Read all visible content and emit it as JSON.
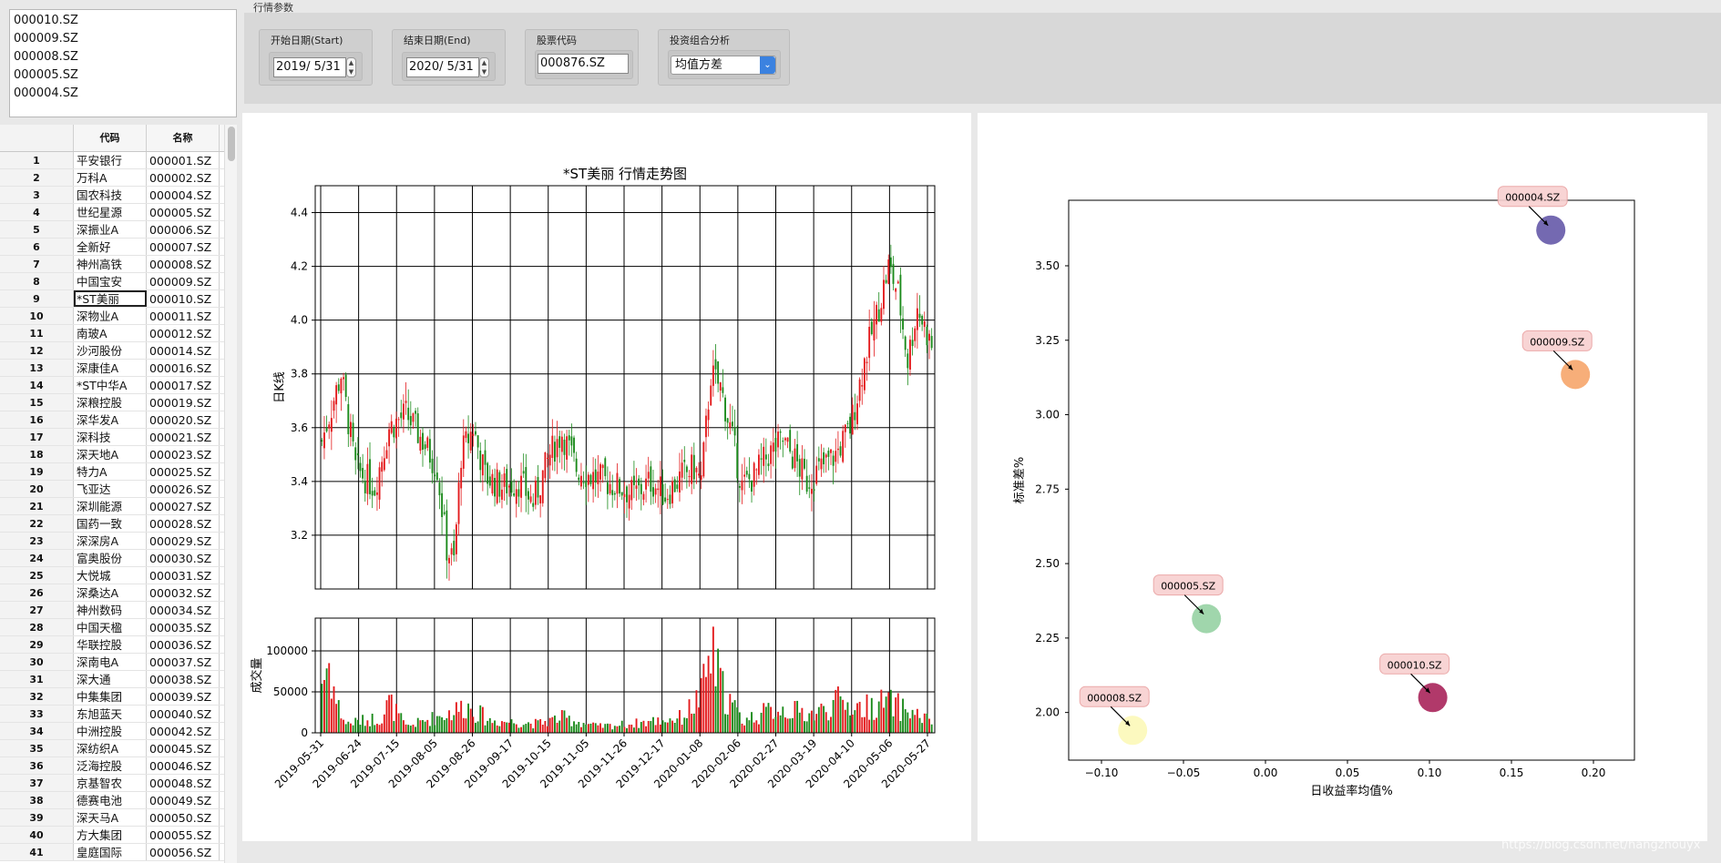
{
  "selected_list": [
    "000010.SZ",
    "000009.SZ",
    "000008.SZ",
    "000005.SZ",
    "000004.SZ"
  ],
  "table": {
    "headers": {
      "num": "",
      "col1": "代码",
      "col2": "名称"
    },
    "selected_row": 9,
    "rows": [
      {
        "num": "1",
        "name": "平安银行",
        "code": "000001.SZ"
      },
      {
        "num": "2",
        "name": "万科A",
        "code": "000002.SZ"
      },
      {
        "num": "3",
        "name": "国农科技",
        "code": "000004.SZ"
      },
      {
        "num": "4",
        "name": "世纪星源",
        "code": "000005.SZ"
      },
      {
        "num": "5",
        "name": "深振业A",
        "code": "000006.SZ"
      },
      {
        "num": "6",
        "name": "全新好",
        "code": "000007.SZ"
      },
      {
        "num": "7",
        "name": "神州高铁",
        "code": "000008.SZ"
      },
      {
        "num": "8",
        "name": "中国宝安",
        "code": "000009.SZ"
      },
      {
        "num": "9",
        "name": "*ST美丽",
        "code": "000010.SZ"
      },
      {
        "num": "10",
        "name": "深物业A",
        "code": "000011.SZ"
      },
      {
        "num": "11",
        "name": "南玻A",
        "code": "000012.SZ"
      },
      {
        "num": "12",
        "name": "沙河股份",
        "code": "000014.SZ"
      },
      {
        "num": "13",
        "name": "深康佳A",
        "code": "000016.SZ"
      },
      {
        "num": "14",
        "name": "*ST中华A",
        "code": "000017.SZ"
      },
      {
        "num": "15",
        "name": "深粮控股",
        "code": "000019.SZ"
      },
      {
        "num": "16",
        "name": "深华发A",
        "code": "000020.SZ"
      },
      {
        "num": "17",
        "name": "深科技",
        "code": "000021.SZ"
      },
      {
        "num": "18",
        "name": "深天地A",
        "code": "000023.SZ"
      },
      {
        "num": "19",
        "name": "特力A",
        "code": "000025.SZ"
      },
      {
        "num": "20",
        "name": "飞亚达",
        "code": "000026.SZ"
      },
      {
        "num": "21",
        "name": "深圳能源",
        "code": "000027.SZ"
      },
      {
        "num": "22",
        "name": "国药一致",
        "code": "000028.SZ"
      },
      {
        "num": "23",
        "name": "深深房A",
        "code": "000029.SZ"
      },
      {
        "num": "24",
        "name": "富奥股份",
        "code": "000030.SZ"
      },
      {
        "num": "25",
        "name": "大悦城",
        "code": "000031.SZ"
      },
      {
        "num": "26",
        "name": "深桑达A",
        "code": "000032.SZ"
      },
      {
        "num": "27",
        "name": "神州数码",
        "code": "000034.SZ"
      },
      {
        "num": "28",
        "name": "中国天楹",
        "code": "000035.SZ"
      },
      {
        "num": "29",
        "name": "华联控股",
        "code": "000036.SZ"
      },
      {
        "num": "30",
        "name": "深南电A",
        "code": "000037.SZ"
      },
      {
        "num": "31",
        "name": "深大通",
        "code": "000038.SZ"
      },
      {
        "num": "32",
        "name": "中集集团",
        "code": "000039.SZ"
      },
      {
        "num": "33",
        "name": "东旭蓝天",
        "code": "000040.SZ"
      },
      {
        "num": "34",
        "name": "中洲控股",
        "code": "000042.SZ"
      },
      {
        "num": "35",
        "name": "深纺织A",
        "code": "000045.SZ"
      },
      {
        "num": "36",
        "name": "泛海控股",
        "code": "000046.SZ"
      },
      {
        "num": "37",
        "name": "京基智农",
        "code": "000048.SZ"
      },
      {
        "num": "38",
        "name": "德赛电池",
        "code": "000049.SZ"
      },
      {
        "num": "39",
        "name": "深天马A",
        "code": "000050.SZ"
      },
      {
        "num": "40",
        "name": "方大集团",
        "code": "000055.SZ"
      },
      {
        "num": "41",
        "name": "皇庭国际",
        "code": "000056.SZ"
      }
    ]
  },
  "params": {
    "title": "行情参数",
    "start_label": "开始日期(Start)",
    "start_value": "2019/  5/31",
    "end_label": "结束日期(End)",
    "end_value": "2020/  5/31",
    "code_label": "股票代码",
    "code_value": "000876.SZ",
    "analysis_label": "投资组合分析",
    "analysis_value": "均值方差"
  },
  "chart_data": [
    {
      "type": "candlestick",
      "title": "*ST美丽 行情走势图",
      "ylabel": "日K线",
      "ylim": [
        3.0,
        4.5
      ],
      "yticks": [
        3.2,
        3.4,
        3.6,
        3.8,
        4.0,
        4.2,
        4.4
      ],
      "up_color": "#e31a1c",
      "down_color": "#1a8a1a",
      "x_start": "2019-05-31",
      "x_end": "2020-05-29",
      "xticks": [
        "2019-05-31",
        "2019-06-24",
        "2019-07-15",
        "2019-08-05",
        "2019-08-26",
        "2019-09-17",
        "2019-10-15",
        "2019-11-05",
        "2019-11-26",
        "2019-12-17",
        "2020-01-08",
        "2020-02-06",
        "2020-02-27",
        "2020-03-19",
        "2020-04-10",
        "2020-05-06",
        "2020-05-27"
      ],
      "close_anchors": [
        [
          0,
          3.55
        ],
        [
          8,
          3.8
        ],
        [
          14,
          3.45
        ],
        [
          22,
          3.38
        ],
        [
          28,
          3.6
        ],
        [
          35,
          3.65
        ],
        [
          42,
          3.55
        ],
        [
          48,
          3.45
        ],
        [
          52,
          3.15
        ],
        [
          55,
          3.1
        ],
        [
          58,
          3.5
        ],
        [
          63,
          3.6
        ],
        [
          68,
          3.42
        ],
        [
          75,
          3.38
        ],
        [
          82,
          3.4
        ],
        [
          88,
          3.32
        ],
        [
          95,
          3.5
        ],
        [
          100,
          3.58
        ],
        [
          106,
          3.45
        ],
        [
          112,
          3.42
        ],
        [
          118,
          3.4
        ],
        [
          124,
          3.38
        ],
        [
          130,
          3.35
        ],
        [
          137,
          3.4
        ],
        [
          143,
          3.35
        ],
        [
          150,
          3.42
        ],
        [
          155,
          3.45
        ],
        [
          158,
          3.4
        ],
        [
          162,
          3.8
        ],
        [
          166,
          3.75
        ],
        [
          170,
          3.6
        ],
        [
          175,
          3.38
        ],
        [
          180,
          3.42
        ],
        [
          186,
          3.5
        ],
        [
          192,
          3.55
        ],
        [
          197,
          3.48
        ],
        [
          202,
          3.4
        ],
        [
          208,
          3.45
        ],
        [
          214,
          3.5
        ],
        [
          220,
          3.6
        ],
        [
          226,
          3.85
        ],
        [
          232,
          4.05
        ],
        [
          236,
          4.2
        ],
        [
          240,
          4.1
        ],
        [
          244,
          3.85
        ],
        [
          248,
          4.05
        ],
        [
          252,
          3.95
        ],
        [
          254,
          3.9
        ]
      ],
      "volume": {
        "ylabel": "成交量",
        "ylim": [
          0,
          140000
        ],
        "yticks": [
          0,
          50000,
          100000
        ],
        "peaks": [
          [
            0,
            85000
          ],
          [
            3,
            115000
          ],
          [
            6,
            50000
          ],
          [
            10,
            15000
          ],
          [
            25,
            25000
          ],
          [
            28,
            50000
          ],
          [
            35,
            10000
          ],
          [
            55,
            35000
          ],
          [
            60,
            45000
          ],
          [
            70,
            20000
          ],
          [
            90,
            15000
          ],
          [
            100,
            25000
          ],
          [
            115,
            10000
          ],
          [
            130,
            15000
          ],
          [
            150,
            25000
          ],
          [
            158,
            60000
          ],
          [
            162,
            130000
          ],
          [
            167,
            70000
          ],
          [
            175,
            20000
          ],
          [
            190,
            40000
          ],
          [
            205,
            30000
          ],
          [
            215,
            50000
          ],
          [
            225,
            40000
          ],
          [
            235,
            50000
          ],
          [
            245,
            35000
          ],
          [
            254,
            18000
          ]
        ]
      }
    },
    {
      "type": "scatter",
      "xlabel": "日收益率均值%",
      "ylabel": "标准差%",
      "xlim": [
        -0.12,
        0.225
      ],
      "ylim": [
        1.84,
        3.72
      ],
      "xticks": [
        -0.1,
        -0.05,
        0.0,
        0.05,
        0.1,
        0.15,
        0.2
      ],
      "xticklabels": [
        "−0.10",
        "−0.05",
        "0.00",
        "0.05",
        "0.10",
        "0.15",
        "0.20"
      ],
      "yticks": [
        2.0,
        2.25,
        2.5,
        2.75,
        3.0,
        3.25,
        3.5
      ],
      "yticklabels": [
        "2.00",
        "2.25",
        "2.50",
        "2.75",
        "3.00",
        "3.25",
        "3.50"
      ],
      "points": [
        {
          "name": "000004.SZ",
          "x": 0.174,
          "y": 3.62,
          "color": "#5c4fa3"
        },
        {
          "name": "000009.SZ",
          "x": 0.189,
          "y": 3.135,
          "color": "#f6a062"
        },
        {
          "name": "000005.SZ",
          "x": -0.036,
          "y": 2.315,
          "color": "#8fcf9e"
        },
        {
          "name": "000010.SZ",
          "x": 0.102,
          "y": 2.05,
          "color": "#a31650"
        },
        {
          "name": "000008.SZ",
          "x": -0.081,
          "y": 1.94,
          "color": "#fcf8b4"
        }
      ]
    }
  ],
  "watermark": "https://blog.csdn.net/hangzhouyx"
}
